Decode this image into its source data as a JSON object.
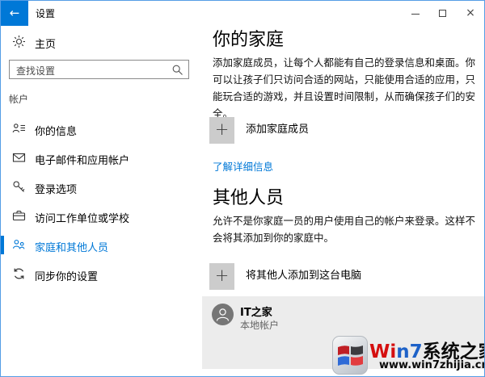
{
  "window": {
    "title": "设置",
    "back_glyph": "←"
  },
  "sidebar": {
    "home_label": "主页",
    "search_placeholder": "查找设置",
    "section_label": "帐户",
    "items": [
      {
        "label": "你的信息",
        "icon": "user-info-icon",
        "selected": false
      },
      {
        "label": "电子邮件和应用帐户",
        "icon": "email-icon",
        "selected": false
      },
      {
        "label": "登录选项",
        "icon": "key-icon",
        "selected": false
      },
      {
        "label": "访问工作单位或学校",
        "icon": "briefcase-icon",
        "selected": false
      },
      {
        "label": "家庭和其他人员",
        "icon": "people-icon",
        "selected": true
      },
      {
        "label": "同步你的设置",
        "icon": "sync-icon",
        "selected": false
      }
    ]
  },
  "content": {
    "family": {
      "title": "你的家庭",
      "description": "添加家庭成员，让每个人都能有自己的登录信息和桌面。你可以让孩子们只访问合适的网站，只能使用合适的应用，只能玩合适的游戏，并且设置时间限制，从而确保孩子们的安全。",
      "add_icon": "+",
      "add_button_label": "添加家庭成员",
      "learn_more_link": "了解详细信息"
    },
    "others": {
      "title": "其他人员",
      "description": "允许不是你家庭一员的用户使用自己的帐户来登录。这样不会将其添加到你的家庭中。",
      "add_icon": "+",
      "add_button_label": "将其他人添加到这台电脑",
      "user": {
        "name": "IT之家",
        "account_type": "本地帐户"
      }
    }
  },
  "watermark": {
    "brand_red": "Wi",
    "brand_blue": "n7",
    "brand_black": "系统之家",
    "url": "www.win7zhijia.cn"
  },
  "colors": {
    "accent": "#0078d7",
    "window_border": "#559de5",
    "tile_bg": "#ececec",
    "add_btn_bg": "#cccccc",
    "avatar_bg": "#767676"
  }
}
